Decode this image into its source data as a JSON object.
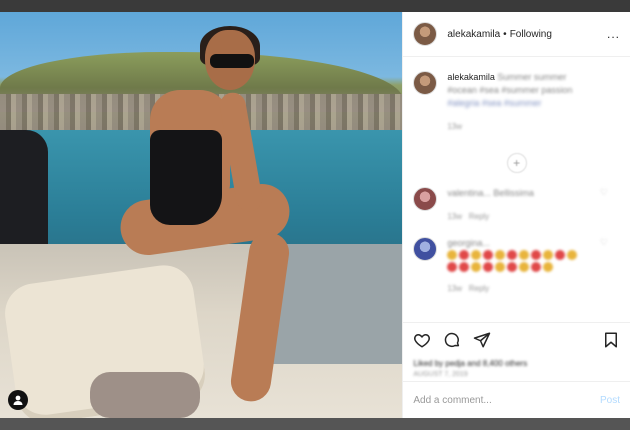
{
  "header": {
    "username": "alekakamila",
    "separator": "•",
    "follow_status": "Following",
    "more_label": "..."
  },
  "caption": {
    "username": "alekakamila",
    "text": "Summer summer #ocean #sea #summer passion",
    "hashtags": "#alegria #sea #summer",
    "time": "13w"
  },
  "comments": [
    {
      "username": "valentina...",
      "text": "Bellissima",
      "time": "13w",
      "reply": "Reply"
    },
    {
      "username": "georgina...",
      "time": "13w",
      "reply": "Reply"
    }
  ],
  "actions": {
    "like_icon": "heart-icon",
    "comment_icon": "comment-icon",
    "share_icon": "share-icon",
    "save_icon": "bookmark-icon"
  },
  "likes_text": "Liked by pedja and 8,400 others",
  "date_text": "AUGUST 7, 2019",
  "add_comment": {
    "placeholder": "Add a comment...",
    "post_label": "Post"
  },
  "colors": {
    "accent": "#0095f6",
    "post_disabled": "#b3dbff",
    "text": "#262626",
    "muted": "#999999"
  }
}
